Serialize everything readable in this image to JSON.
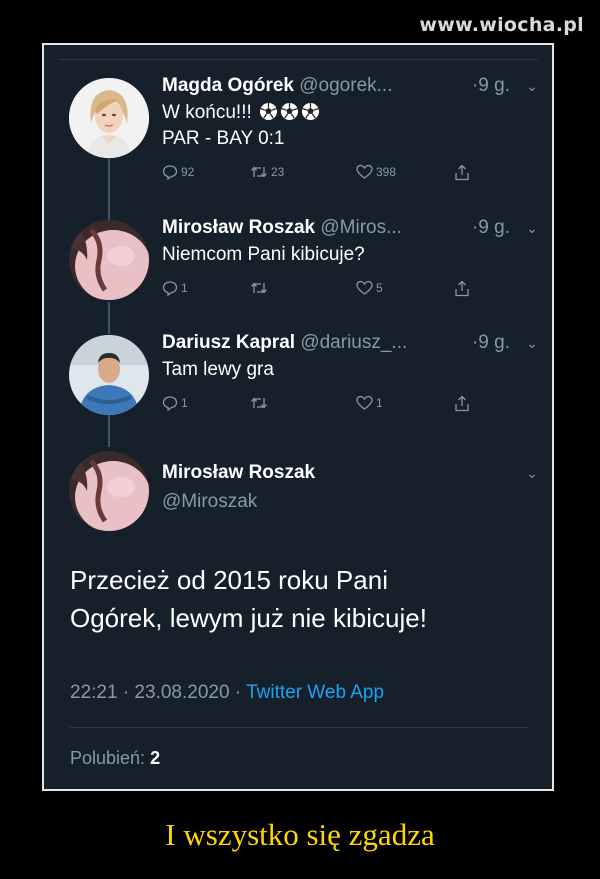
{
  "watermark": "www.wiocha.pl",
  "tweets": [
    {
      "name": "Magda Ogórek",
      "handle": "@ogorek...",
      "time": "·9 g.",
      "line1": "W końcu!!!",
      "line2": "PAR - BAY 0:1",
      "replies": "92",
      "retweets": "23",
      "likes": "398"
    },
    {
      "name": "Mirosław Roszak",
      "handle": "@Miros...",
      "time": "·9 g.",
      "line1": "Niemcom Pani kibicuje?",
      "replies": "1",
      "retweets": "",
      "likes": "5"
    },
    {
      "name": "Dariusz Kapral",
      "handle": "@dariusz_...",
      "time": "·9 g.",
      "line1": "Tam lewy gra",
      "replies": "1",
      "retweets": "",
      "likes": "1"
    }
  ],
  "main": {
    "name": "Mirosław Roszak",
    "handle": "@Miroszak",
    "text_line1": "Przecież od 2015 roku Pani",
    "text_line2": "Ogórek, lewym już nie kibicuje!",
    "timestamp": "22:21 · 23.08.2020 · ",
    "app": "Twitter Web App",
    "likes_label": "Polubień:",
    "likes_count": "2"
  },
  "caption": "I wszystko się zgadza",
  "colors": {
    "background": "#15202b",
    "link": "#1da1f2",
    "muted": "#8899a6",
    "caption": "#ffd600"
  },
  "icons": [
    "reply-icon",
    "retweet-icon",
    "like-icon",
    "share-icon",
    "chevron-down-icon",
    "soccer-ball-icon"
  ]
}
